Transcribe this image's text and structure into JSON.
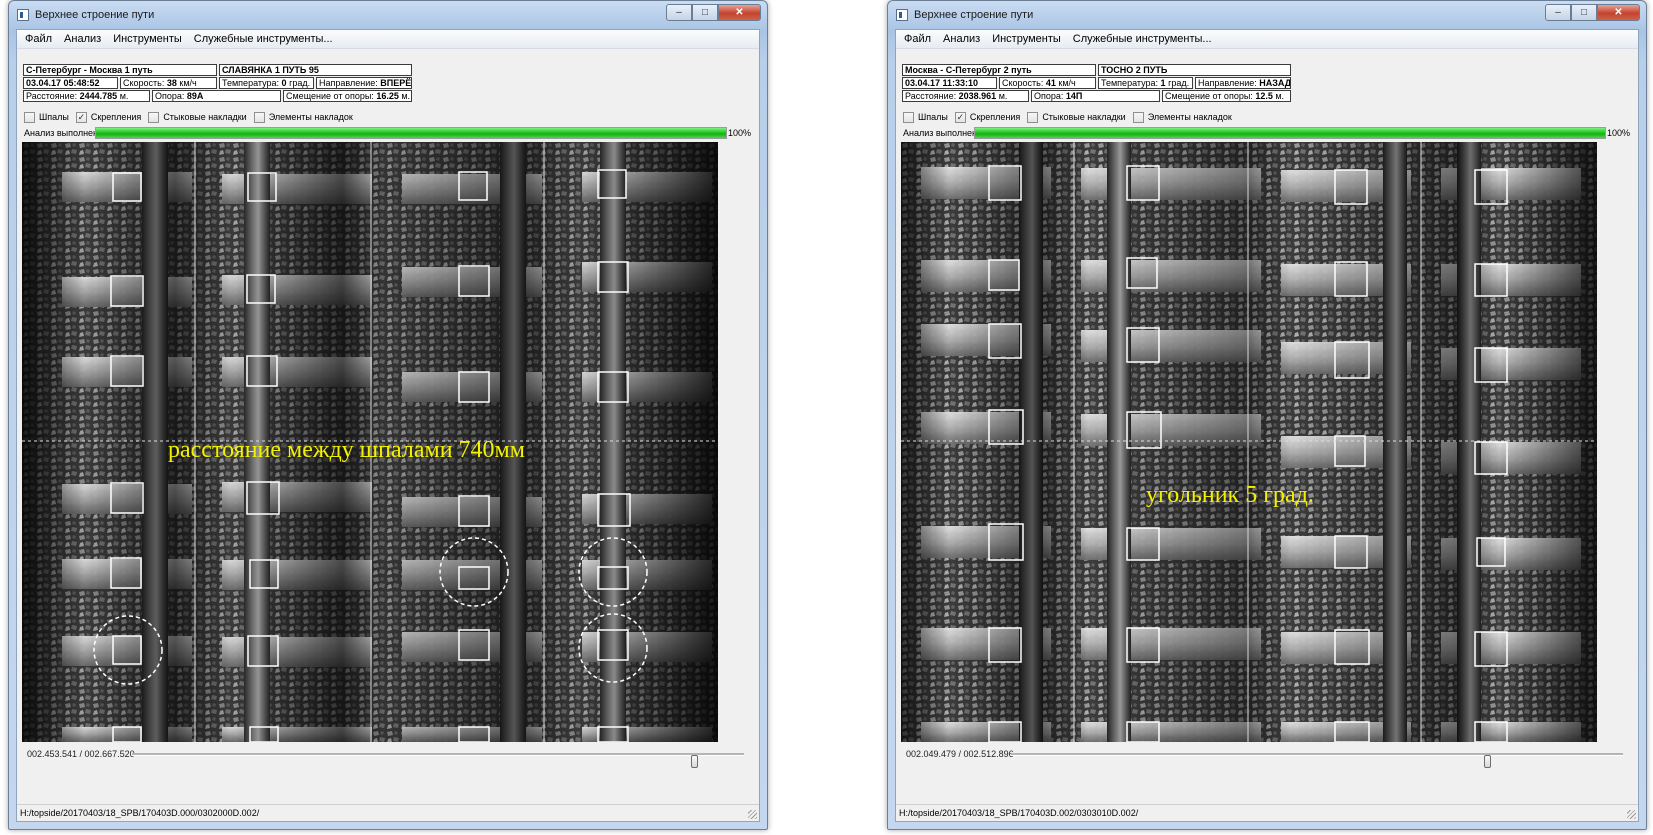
{
  "windows": [
    {
      "title": "Верхнее строение пути",
      "caption_buttons": {
        "minimize": "–",
        "maximize": "□",
        "close": "✕"
      },
      "menu": [
        "Файл",
        "Анализ",
        "Инструменты",
        "Служебные инструменты..."
      ],
      "info": {
        "route": "С-Петербург - Москва 1 путь",
        "track": "СЛАВЯНКА 1 ПУТЬ 95",
        "datetime": "03.04.17 05:48:52",
        "speed_label": "Скорость:",
        "speed_value": "38",
        "speed_unit": "км/ч",
        "temp_label": "Температура:",
        "temp_value": "0",
        "temp_unit": "град.",
        "direction_label": "Направление:",
        "direction_value": "ВПЕРЁД",
        "distance_label": "Расстояние:",
        "distance_value": "2444.785",
        "distance_unit": "м.",
        "pole_label": "Опора:",
        "pole_value": "89А",
        "offset_label": "Смещение от опоры:",
        "offset_value": "16.25",
        "offset_unit": "м."
      },
      "checkboxes": [
        {
          "label": "Шпалы",
          "checked": false
        },
        {
          "label": "Скрепления",
          "checked": true
        },
        {
          "label": "Стыковые накладки",
          "checked": false
        },
        {
          "label": "Элементы накладок",
          "checked": false
        }
      ],
      "progress": {
        "label": "Анализ выполнен",
        "value": 1.0,
        "text": "100%"
      },
      "annotation": "расстояние между шпалами 740мм",
      "position_text": "002.453.541 / 002.667.520",
      "slider_value": 0.92,
      "status_path": "H:/topside/20170403/18_SPB/170403D.000/0302000D.002/"
    },
    {
      "title": "Верхнее строение пути",
      "caption_buttons": {
        "minimize": "–",
        "maximize": "□",
        "close": "✕"
      },
      "menu": [
        "Файл",
        "Анализ",
        "Инструменты",
        "Служебные инструменты..."
      ],
      "info": {
        "route": "Москва - С-Петербург 2 путь",
        "track": "ТОСНО 2 ПУТЬ",
        "datetime": "03.04.17 11:33:10",
        "speed_label": "Скорость:",
        "speed_value": "41",
        "speed_unit": "км/ч",
        "temp_label": "Температура:",
        "temp_value": "1",
        "temp_unit": "град.",
        "direction_label": "Направление:",
        "direction_value": "НАЗАД",
        "distance_label": "Расстояние:",
        "distance_value": "2038.961",
        "distance_unit": "м.",
        "pole_label": "Опора:",
        "pole_value": "14П",
        "offset_label": "Смещение от опоры:",
        "offset_value": "12.5",
        "offset_unit": "м."
      },
      "checkboxes": [
        {
          "label": "Шпалы",
          "checked": false
        },
        {
          "label": "Скрепления",
          "checked": true
        },
        {
          "label": "Стыковые накладки",
          "checked": false
        },
        {
          "label": "Элементы накладок",
          "checked": false
        }
      ],
      "progress": {
        "label": "Анализ выполнен",
        "value": 1.0,
        "text": "100%"
      },
      "annotation": "угольник 5 град.",
      "position_text": "002.049.479 / 002.512.896",
      "slider_value": 0.78,
      "status_path": "H:/topside/20170403/18_SPB/170403D.002/0303010D.002/"
    }
  ],
  "colors": {
    "progress": "#1fc21f",
    "annotation": "#f3f000",
    "detection_box": "#ffffff"
  }
}
